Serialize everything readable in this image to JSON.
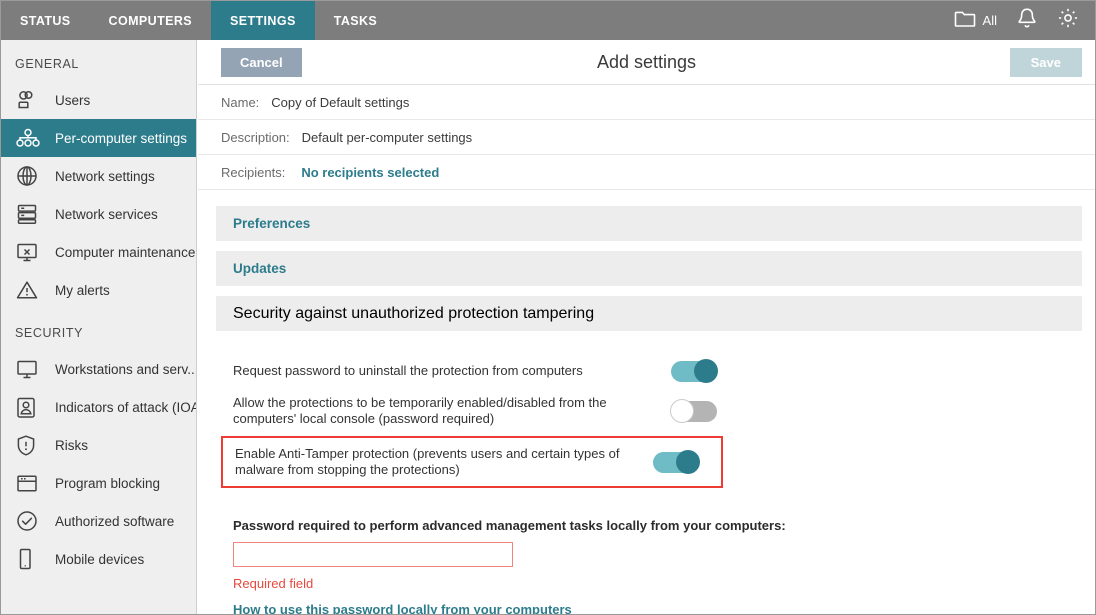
{
  "topbar": {
    "tabs": [
      {
        "label": "STATUS",
        "active": false
      },
      {
        "label": "COMPUTERS",
        "active": false
      },
      {
        "label": "SETTINGS",
        "active": true
      },
      {
        "label": "TASKS",
        "active": false
      }
    ],
    "folder_label": "All",
    "icons": [
      "folder-icon",
      "bell-icon",
      "gear-icon"
    ],
    "active_color": "#2c7c8c",
    "bar_color": "#7d7d7d"
  },
  "sidebar": {
    "groups": [
      {
        "title": "GENERAL",
        "items": [
          {
            "label": "Users",
            "icon": "users-icon",
            "active": false
          },
          {
            "label": "Per-computer settings",
            "icon": "network-nodes-icon",
            "active": true
          },
          {
            "label": "Network settings",
            "icon": "globe-icon",
            "active": false
          },
          {
            "label": "Network services",
            "icon": "servers-icon",
            "active": false
          },
          {
            "label": "Computer maintenance",
            "icon": "monitor-x-icon",
            "active": false
          },
          {
            "label": "My alerts",
            "icon": "warning-triangle-icon",
            "active": false
          }
        ]
      },
      {
        "title": "SECURITY",
        "items": [
          {
            "label": "Workstations and serv...",
            "icon": "monitor-icon",
            "active": false
          },
          {
            "label": "Indicators of attack (IOA)",
            "icon": "person-badge-icon",
            "active": false
          },
          {
            "label": "Risks",
            "icon": "shield-alert-icon",
            "active": false
          },
          {
            "label": "Program blocking",
            "icon": "window-icon",
            "active": false
          },
          {
            "label": "Authorized software",
            "icon": "check-circle-icon",
            "active": false
          },
          {
            "label": "Mobile devices",
            "icon": "phone-icon",
            "active": false
          }
        ]
      }
    ]
  },
  "main": {
    "cancel_label": "Cancel",
    "title": "Add settings",
    "save_label": "Save",
    "meta": [
      {
        "key": "Name:",
        "value": "Copy of Default settings",
        "is_link": false
      },
      {
        "key": "Description:",
        "value": "Default per-computer settings",
        "is_link": false
      },
      {
        "key": "Recipients:",
        "value": "No recipients selected",
        "is_link": true
      }
    ],
    "sections": [
      {
        "title": "Preferences",
        "expanded": false
      },
      {
        "title": "Updates",
        "expanded": false
      },
      {
        "title": "Security against unauthorized protection tampering",
        "expanded": true
      }
    ],
    "security_section": {
      "toggles": [
        {
          "label": "Request password to uninstall the protection from computers",
          "state": "on",
          "highlighted": false
        },
        {
          "label": "Allow the protections to be temporarily enabled/disabled from the computers' local console (password required)",
          "state": "off",
          "highlighted": false
        },
        {
          "label": "Enable Anti-Tamper protection (prevents users and certain types of malware from stopping the protections)",
          "state": "on",
          "highlighted": true
        }
      ],
      "password": {
        "title": "Password required to perform advanced management tasks locally from your computers:",
        "value": "",
        "error": "Required field",
        "help_link": "How to use this password locally from your computers"
      }
    }
  },
  "colors": {
    "teal": "#2c7c8c",
    "teal_light": "#6fbcc6",
    "red_highlight": "#ee3b33",
    "error_red": "#e8483f",
    "cancel_btn": "#94a4b4",
    "save_btn_disabled": "#bfd5da"
  }
}
